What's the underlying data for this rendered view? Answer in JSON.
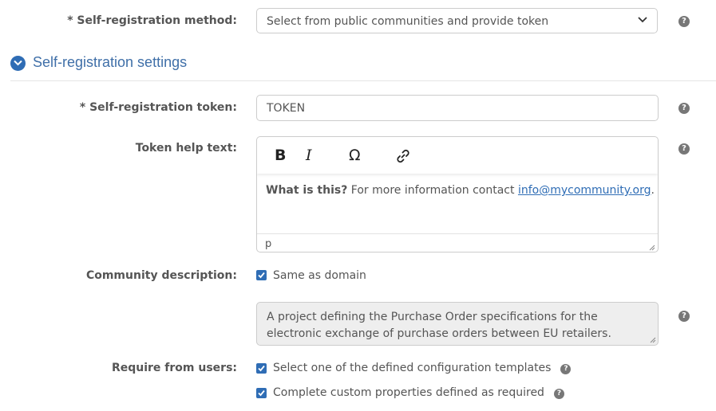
{
  "registration_method": {
    "label": "* Self-registration method:",
    "selected": "Select from public communities and provide token"
  },
  "section": {
    "title": "Self-registration settings"
  },
  "token": {
    "label": "* Self-registration token:",
    "value": "TOKEN"
  },
  "help_text": {
    "label": "Token help text:",
    "toolbar": {
      "bold": "B",
      "italic": "I",
      "special_char": "Ω"
    },
    "content_bold": "What is this?",
    "content_text": " For more information contact ",
    "content_link": "info@mycommunity.org",
    "content_end": ".",
    "status_path": "p"
  },
  "community_description": {
    "label": "Community description:",
    "same_as_domain": "Same as domain",
    "text": "A project defining the Purchase Order specifications for the electronic exchange of purchase orders between EU retailers."
  },
  "require_from_users": {
    "label": "Require from users:",
    "options": [
      "Select one of the defined configuration templates",
      "Complete custom properties defined as required"
    ]
  },
  "help_glyph": "?",
  "colors": {
    "accent": "#2f6db5",
    "heading": "#3f6fa8",
    "help_icon": "#777777"
  }
}
